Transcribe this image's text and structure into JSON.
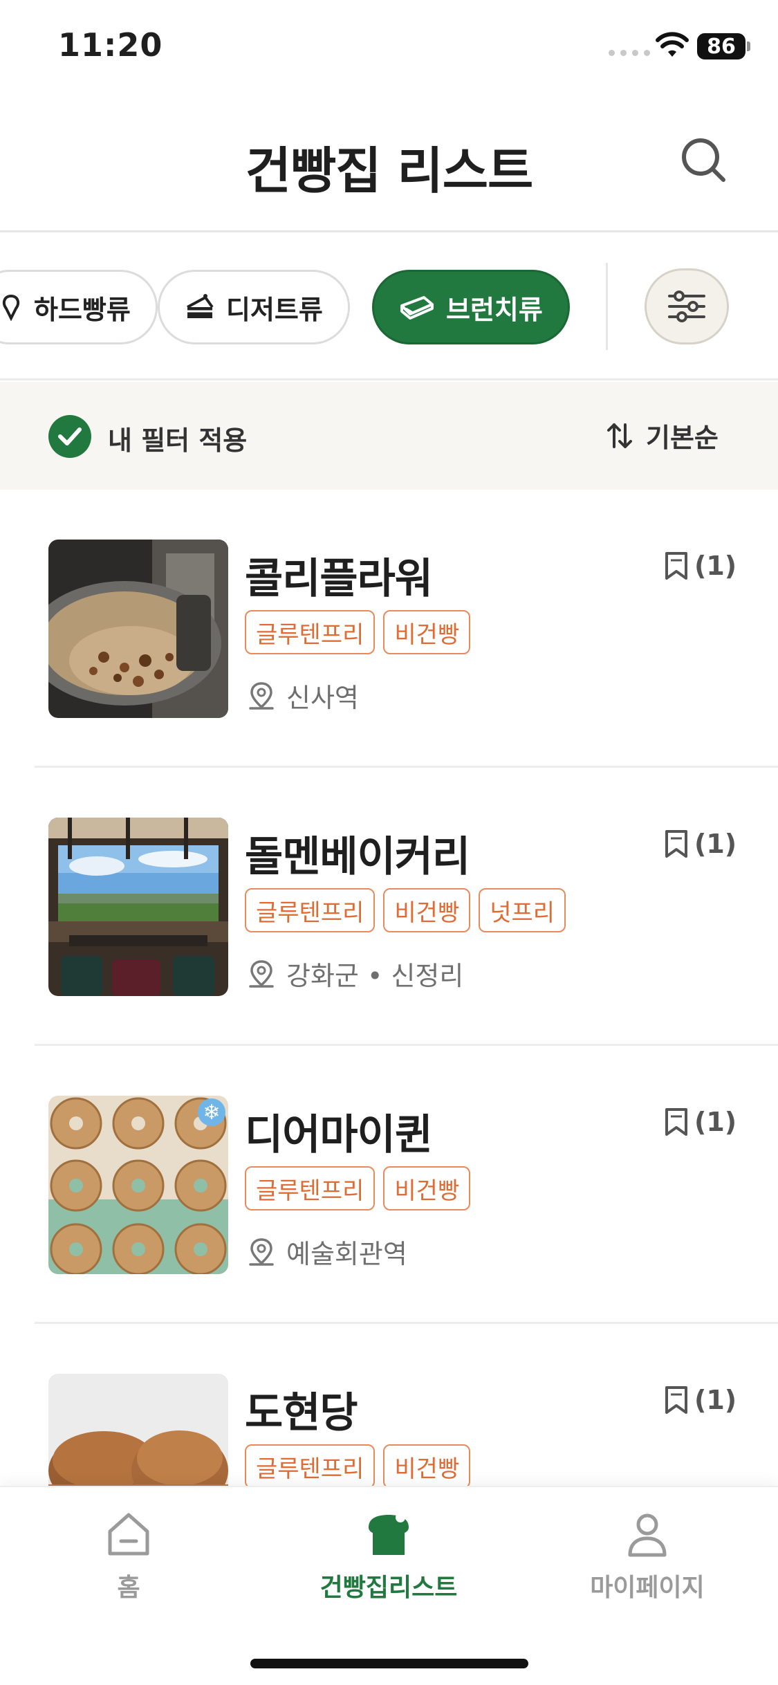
{
  "status_bar": {
    "time": "11:20",
    "battery": "86"
  },
  "header": {
    "title": "건빵집 리스트"
  },
  "categories": [
    {
      "label": "하드빵류",
      "icon": "hard-bread-icon",
      "active": false
    },
    {
      "label": "디저트류",
      "icon": "cake-icon",
      "active": false
    },
    {
      "label": "브런치류",
      "icon": "sandwich-icon",
      "active": true
    }
  ],
  "filter_bar": {
    "my_filter_label": "내 필터 적용",
    "sort_label": "기본순"
  },
  "bakeries": [
    {
      "name": "콜리플라워",
      "bookmark_count": "(1)",
      "tags": [
        "글루텐프리",
        "비건빵"
      ],
      "location": "신사역",
      "frozen": false
    },
    {
      "name": "돌멘베이커리",
      "bookmark_count": "(1)",
      "tags": [
        "글루텐프리",
        "비건빵",
        "넛프리"
      ],
      "location": "강화군 • 신정리",
      "frozen": false
    },
    {
      "name": "디어마이퀸",
      "bookmark_count": "(1)",
      "tags": [
        "글루텐프리",
        "비건빵"
      ],
      "location": "예술회관역",
      "frozen": true
    },
    {
      "name": "도현당",
      "bookmark_count": "(1)",
      "tags": [
        "글루텐프리",
        "비건빵"
      ],
      "location": "",
      "frozen": false
    }
  ],
  "bottom_nav": [
    {
      "label": "홈",
      "icon": "home-icon",
      "active": false
    },
    {
      "label": "건빵집리스트",
      "icon": "bread-icon",
      "active": true
    },
    {
      "label": "마이페이지",
      "icon": "person-icon",
      "active": false
    }
  ],
  "colors": {
    "brand_green": "#21793f",
    "tag_orange": "#e06c35",
    "filter_bg": "#f8f6f2"
  }
}
